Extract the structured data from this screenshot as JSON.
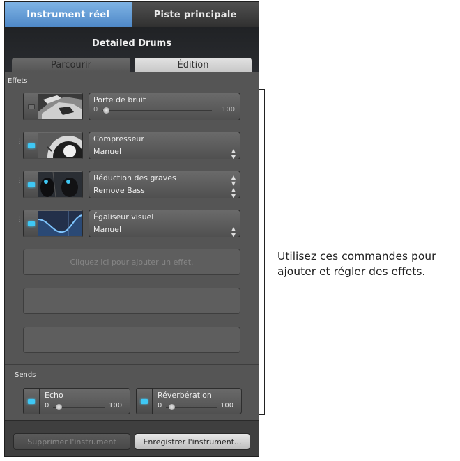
{
  "top_tabs": [
    {
      "label": "Instrument réel",
      "active": true
    },
    {
      "label": "Piste principale",
      "active": false
    }
  ],
  "header": {
    "title": "Detailed Drums"
  },
  "sub_tabs": [
    {
      "label": "Parcourir",
      "active": false
    },
    {
      "label": "Édition",
      "active": true
    }
  ],
  "effects": {
    "section_label": "Effets",
    "items": [
      {
        "name": "Porte de bruit",
        "control": "slider",
        "min": "0",
        "max": "100",
        "value": 0.05,
        "enabled": false,
        "thumb": "noise-gate-thumb"
      },
      {
        "name": "Compresseur",
        "control": "popup",
        "preset": "Manuel",
        "enabled": true,
        "thumb": "compressor-thumb"
      },
      {
        "name": "Réduction des graves",
        "control": "popup-both",
        "preset": "Remove Bass",
        "enabled": true,
        "thumb": "bass-reduction-thumb"
      },
      {
        "name": "Égaliseur visuel",
        "control": "popup",
        "preset": "Manuel",
        "enabled": true,
        "thumb": "visual-eq-thumb"
      }
    ],
    "add_effect_prompt": "Cliquez ici pour ajouter un effet."
  },
  "sends": {
    "section_label": "Sends",
    "items": [
      {
        "name": "Écho",
        "min": "0",
        "max": "100",
        "value": 0.1,
        "enabled": true
      },
      {
        "name": "Réverbération",
        "min": "0",
        "max": "100",
        "value": 0.1,
        "enabled": true
      }
    ]
  },
  "footer": {
    "delete_label": "Supprimer l'instrument",
    "save_label": "Enregistrer l'instrument..."
  },
  "callout": {
    "text": "Utilisez ces commandes pour ajouter et régler des effets."
  },
  "colors": {
    "accent_blue": "#4e88c8",
    "led_on": "#3fc8f5",
    "panel_bg": "#555555"
  }
}
